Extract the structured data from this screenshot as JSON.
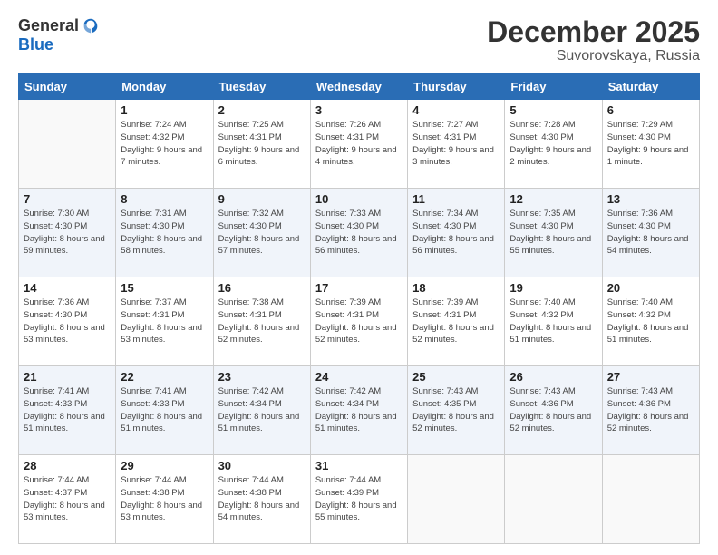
{
  "header": {
    "logo": {
      "line1": "General",
      "line2": "Blue"
    },
    "title": "December 2025",
    "location": "Suvorovskaya, Russia"
  },
  "calendar": {
    "weekdays": [
      "Sunday",
      "Monday",
      "Tuesday",
      "Wednesday",
      "Thursday",
      "Friday",
      "Saturday"
    ],
    "weeks": [
      [
        {
          "day": "",
          "empty": true
        },
        {
          "day": "1",
          "sunrise": "7:24 AM",
          "sunset": "4:32 PM",
          "daylight": "9 hours and 7 minutes."
        },
        {
          "day": "2",
          "sunrise": "7:25 AM",
          "sunset": "4:31 PM",
          "daylight": "9 hours and 6 minutes."
        },
        {
          "day": "3",
          "sunrise": "7:26 AM",
          "sunset": "4:31 PM",
          "daylight": "9 hours and 4 minutes."
        },
        {
          "day": "4",
          "sunrise": "7:27 AM",
          "sunset": "4:31 PM",
          "daylight": "9 hours and 3 minutes."
        },
        {
          "day": "5",
          "sunrise": "7:28 AM",
          "sunset": "4:30 PM",
          "daylight": "9 hours and 2 minutes."
        },
        {
          "day": "6",
          "sunrise": "7:29 AM",
          "sunset": "4:30 PM",
          "daylight": "9 hours and 1 minute."
        }
      ],
      [
        {
          "day": "7",
          "sunrise": "7:30 AM",
          "sunset": "4:30 PM",
          "daylight": "8 hours and 59 minutes."
        },
        {
          "day": "8",
          "sunrise": "7:31 AM",
          "sunset": "4:30 PM",
          "daylight": "8 hours and 58 minutes."
        },
        {
          "day": "9",
          "sunrise": "7:32 AM",
          "sunset": "4:30 PM",
          "daylight": "8 hours and 57 minutes."
        },
        {
          "day": "10",
          "sunrise": "7:33 AM",
          "sunset": "4:30 PM",
          "daylight": "8 hours and 56 minutes."
        },
        {
          "day": "11",
          "sunrise": "7:34 AM",
          "sunset": "4:30 PM",
          "daylight": "8 hours and 56 minutes."
        },
        {
          "day": "12",
          "sunrise": "7:35 AM",
          "sunset": "4:30 PM",
          "daylight": "8 hours and 55 minutes."
        },
        {
          "day": "13",
          "sunrise": "7:36 AM",
          "sunset": "4:30 PM",
          "daylight": "8 hours and 54 minutes."
        }
      ],
      [
        {
          "day": "14",
          "sunrise": "7:36 AM",
          "sunset": "4:30 PM",
          "daylight": "8 hours and 53 minutes."
        },
        {
          "day": "15",
          "sunrise": "7:37 AM",
          "sunset": "4:31 PM",
          "daylight": "8 hours and 53 minutes."
        },
        {
          "day": "16",
          "sunrise": "7:38 AM",
          "sunset": "4:31 PM",
          "daylight": "8 hours and 52 minutes."
        },
        {
          "day": "17",
          "sunrise": "7:39 AM",
          "sunset": "4:31 PM",
          "daylight": "8 hours and 52 minutes."
        },
        {
          "day": "18",
          "sunrise": "7:39 AM",
          "sunset": "4:31 PM",
          "daylight": "8 hours and 52 minutes."
        },
        {
          "day": "19",
          "sunrise": "7:40 AM",
          "sunset": "4:32 PM",
          "daylight": "8 hours and 51 minutes."
        },
        {
          "day": "20",
          "sunrise": "7:40 AM",
          "sunset": "4:32 PM",
          "daylight": "8 hours and 51 minutes."
        }
      ],
      [
        {
          "day": "21",
          "sunrise": "7:41 AM",
          "sunset": "4:33 PM",
          "daylight": "8 hours and 51 minutes."
        },
        {
          "day": "22",
          "sunrise": "7:41 AM",
          "sunset": "4:33 PM",
          "daylight": "8 hours and 51 minutes."
        },
        {
          "day": "23",
          "sunrise": "7:42 AM",
          "sunset": "4:34 PM",
          "daylight": "8 hours and 51 minutes."
        },
        {
          "day": "24",
          "sunrise": "7:42 AM",
          "sunset": "4:34 PM",
          "daylight": "8 hours and 51 minutes."
        },
        {
          "day": "25",
          "sunrise": "7:43 AM",
          "sunset": "4:35 PM",
          "daylight": "8 hours and 52 minutes."
        },
        {
          "day": "26",
          "sunrise": "7:43 AM",
          "sunset": "4:36 PM",
          "daylight": "8 hours and 52 minutes."
        },
        {
          "day": "27",
          "sunrise": "7:43 AM",
          "sunset": "4:36 PM",
          "daylight": "8 hours and 52 minutes."
        }
      ],
      [
        {
          "day": "28",
          "sunrise": "7:44 AM",
          "sunset": "4:37 PM",
          "daylight": "8 hours and 53 minutes."
        },
        {
          "day": "29",
          "sunrise": "7:44 AM",
          "sunset": "4:38 PM",
          "daylight": "8 hours and 53 minutes."
        },
        {
          "day": "30",
          "sunrise": "7:44 AM",
          "sunset": "4:38 PM",
          "daylight": "8 hours and 54 minutes."
        },
        {
          "day": "31",
          "sunrise": "7:44 AM",
          "sunset": "4:39 PM",
          "daylight": "8 hours and 55 minutes."
        },
        {
          "day": "",
          "empty": true
        },
        {
          "day": "",
          "empty": true
        },
        {
          "day": "",
          "empty": true
        }
      ]
    ]
  }
}
